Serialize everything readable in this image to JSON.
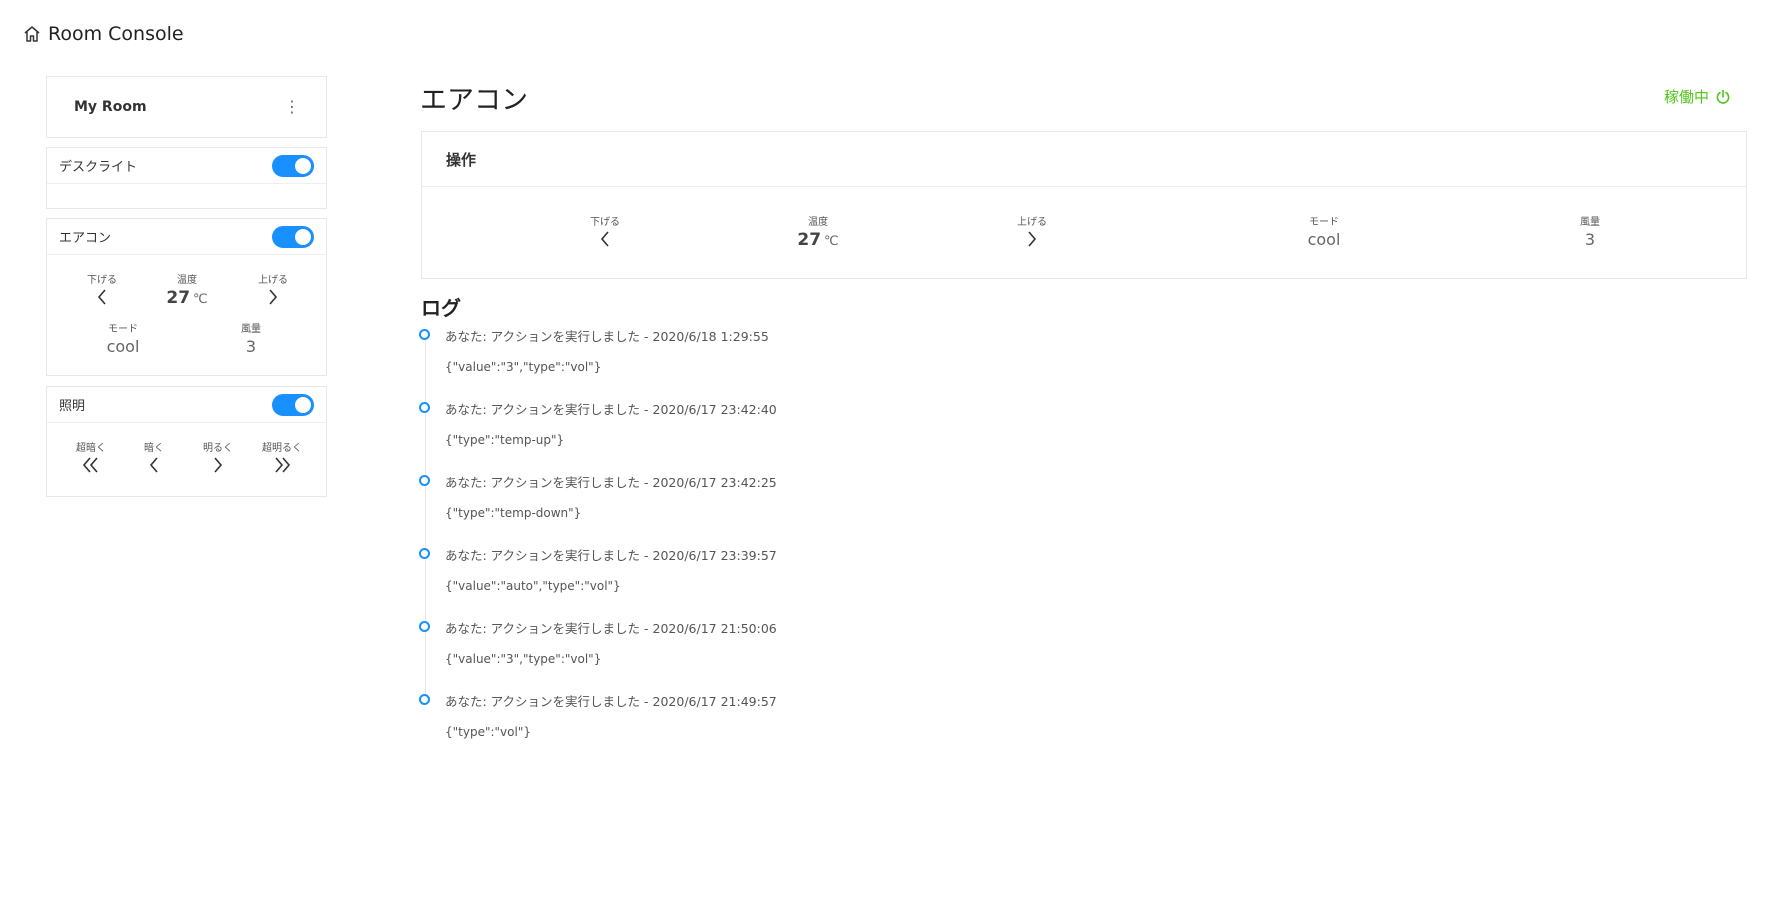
{
  "app": {
    "title": "Room Console",
    "icon": "home-icon"
  },
  "sidebar": {
    "room": {
      "title": "My Room",
      "menu_icon": "more-vertical-icon"
    },
    "desk_light": {
      "title": "デスクライト",
      "on": true
    },
    "aircon": {
      "title": "エアコン",
      "on": true,
      "down_label": "下げる",
      "temp_label": "温度",
      "up_label": "上げる",
      "temp_value": "27",
      "temp_unit": "℃",
      "mode_label": "モード",
      "mode_value": "cool",
      "fan_label": "風量",
      "fan_value": "3"
    },
    "lighting": {
      "title": "照明",
      "on": true,
      "very_dark": "超暗く",
      "dark": "暗く",
      "bright": "明るく",
      "very_bright": "超明るく"
    }
  },
  "main": {
    "title": "エアコン",
    "status": {
      "label": "稼働中",
      "icon": "power-icon",
      "color": "#52c41a"
    },
    "controls": {
      "title": "操作",
      "down_label": "下げる",
      "temp_label": "温度",
      "temp_value": "27",
      "temp_unit": "℃",
      "up_label": "上げる",
      "mode_label": "モード",
      "mode_value": "cool",
      "fan_label": "風量",
      "fan_value": "3"
    },
    "log": {
      "title": "ログ",
      "entries": [
        {
          "head": "あなた: アクションを実行しました - 2020/6/18 1:29:55",
          "body": "{\"value\":\"3\",\"type\":\"vol\"}"
        },
        {
          "head": "あなた: アクションを実行しました - 2020/6/17 23:42:40",
          "body": "{\"type\":\"temp-up\"}"
        },
        {
          "head": "あなた: アクションを実行しました - 2020/6/17 23:42:25",
          "body": "{\"type\":\"temp-down\"}"
        },
        {
          "head": "あなた: アクションを実行しました - 2020/6/17 23:39:57",
          "body": "{\"value\":\"auto\",\"type\":\"vol\"}"
        },
        {
          "head": "あなた: アクションを実行しました - 2020/6/17 21:50:06",
          "body": "{\"value\":\"3\",\"type\":\"vol\"}"
        },
        {
          "head": "あなた: アクションを実行しました - 2020/6/17 21:49:57",
          "body": "{\"type\":\"vol\"}"
        }
      ]
    }
  },
  "colors": {
    "accent": "#1890ff",
    "status": "#52c41a"
  }
}
